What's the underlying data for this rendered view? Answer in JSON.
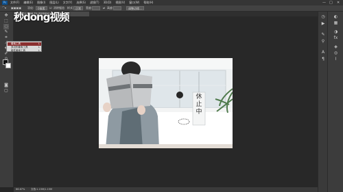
{
  "app": {
    "logo": "Ps"
  },
  "menubar": {
    "items": [
      "文件(F)",
      "编辑(E)",
      "图像(I)",
      "图层(L)",
      "文字(Y)",
      "选择(S)",
      "滤镜(T)",
      "3D(D)",
      "视图(V)",
      "窗口(W)",
      "帮助(H)"
    ],
    "minimize": "—",
    "maximize": "□",
    "close": "✕"
  },
  "options": {
    "feather_label": "羽化:",
    "feather_value": "0像素",
    "antialias_label": "消除锯齿",
    "style_label": "样式:",
    "style_value": "正常",
    "width_label": "宽度:",
    "height_label": "高度:",
    "refine_label": "调整边缘..."
  },
  "document": {
    "tab_label": "未标题-1 @ 66.7% (RGB/8#)",
    "sign_text": "休止中"
  },
  "watermark": {
    "text": "秒dong视频"
  },
  "flyout": {
    "items": [
      {
        "label": "套索工具",
        "shortcut": "L"
      },
      {
        "label": "多边形套索工具",
        "shortcut": "L"
      },
      {
        "label": "磁性套索工具",
        "shortcut": "L"
      }
    ]
  },
  "statusbar": {
    "zoom": "66.67%",
    "doc_info": "文档:1.15M/1.15M"
  },
  "icons": {
    "tools": [
      "move-icon",
      "marquee-icon",
      "lasso-icon",
      "quick-select-icon",
      "crop-icon",
      "eyedropper-icon",
      "healing-icon",
      "brush-icon",
      "stamp-icon",
      "history-brush-icon",
      "eraser-icon",
      "gradient-icon",
      "blur-icon",
      "dodge-icon",
      "pen-icon",
      "type-icon",
      "path-select-icon",
      "shape-icon",
      "hand-icon",
      "zoom-icon"
    ]
  },
  "colors": {
    "selection_highlight": "#8a2f2f",
    "canvas_bg": "#282828"
  }
}
